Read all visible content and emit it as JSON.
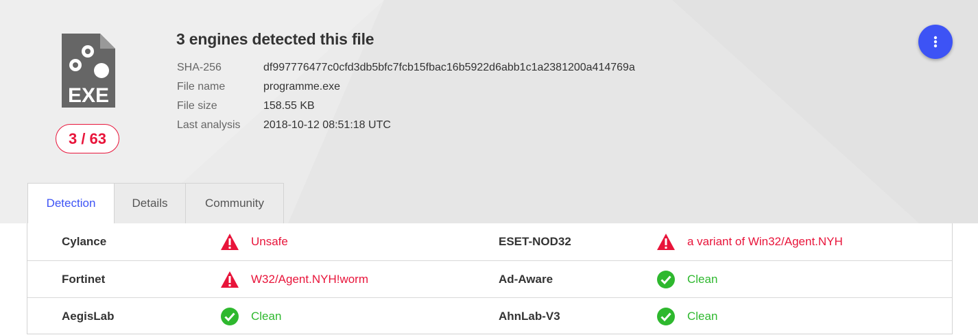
{
  "file": {
    "type_label": "EXE",
    "detection_ratio": "3 / 63",
    "title": "3 engines detected this file",
    "details": [
      {
        "label": "SHA-256",
        "value": "df997776477c0cfd3db5bfc7fcb15fbac16b5922d6abb1c1a2381200a414769a"
      },
      {
        "label": "File name",
        "value": "programme.exe"
      },
      {
        "label": "File size",
        "value": "158.55 KB"
      },
      {
        "label": "Last analysis",
        "value": "2018-10-12 08:51:18 UTC"
      }
    ]
  },
  "tabs": [
    {
      "label": "Detection",
      "active": true
    },
    {
      "label": "Details",
      "active": false
    },
    {
      "label": "Community",
      "active": false
    }
  ],
  "detections": [
    [
      {
        "engine": "Cylance",
        "result": "Unsafe",
        "status": "malicious"
      },
      {
        "engine": "ESET-NOD32",
        "result": "a variant of Win32/Agent.NYH",
        "status": "malicious"
      }
    ],
    [
      {
        "engine": "Fortinet",
        "result": "W32/Agent.NYH!worm",
        "status": "malicious"
      },
      {
        "engine": "Ad-Aware",
        "result": "Clean",
        "status": "clean"
      }
    ],
    [
      {
        "engine": "AegisLab",
        "result": "Clean",
        "status": "clean"
      },
      {
        "engine": "AhnLab-V3",
        "result": "Clean",
        "status": "clean"
      }
    ]
  ],
  "icons": {
    "file": "exe-file-icon",
    "menu": "more-vert-icon",
    "malicious": "warning-triangle-icon",
    "clean": "check-circle-icon"
  },
  "colors": {
    "accent": "#3d53f5",
    "malicious": "#e8143a",
    "clean": "#2eb82e",
    "header_bg": "#ebebeb"
  }
}
